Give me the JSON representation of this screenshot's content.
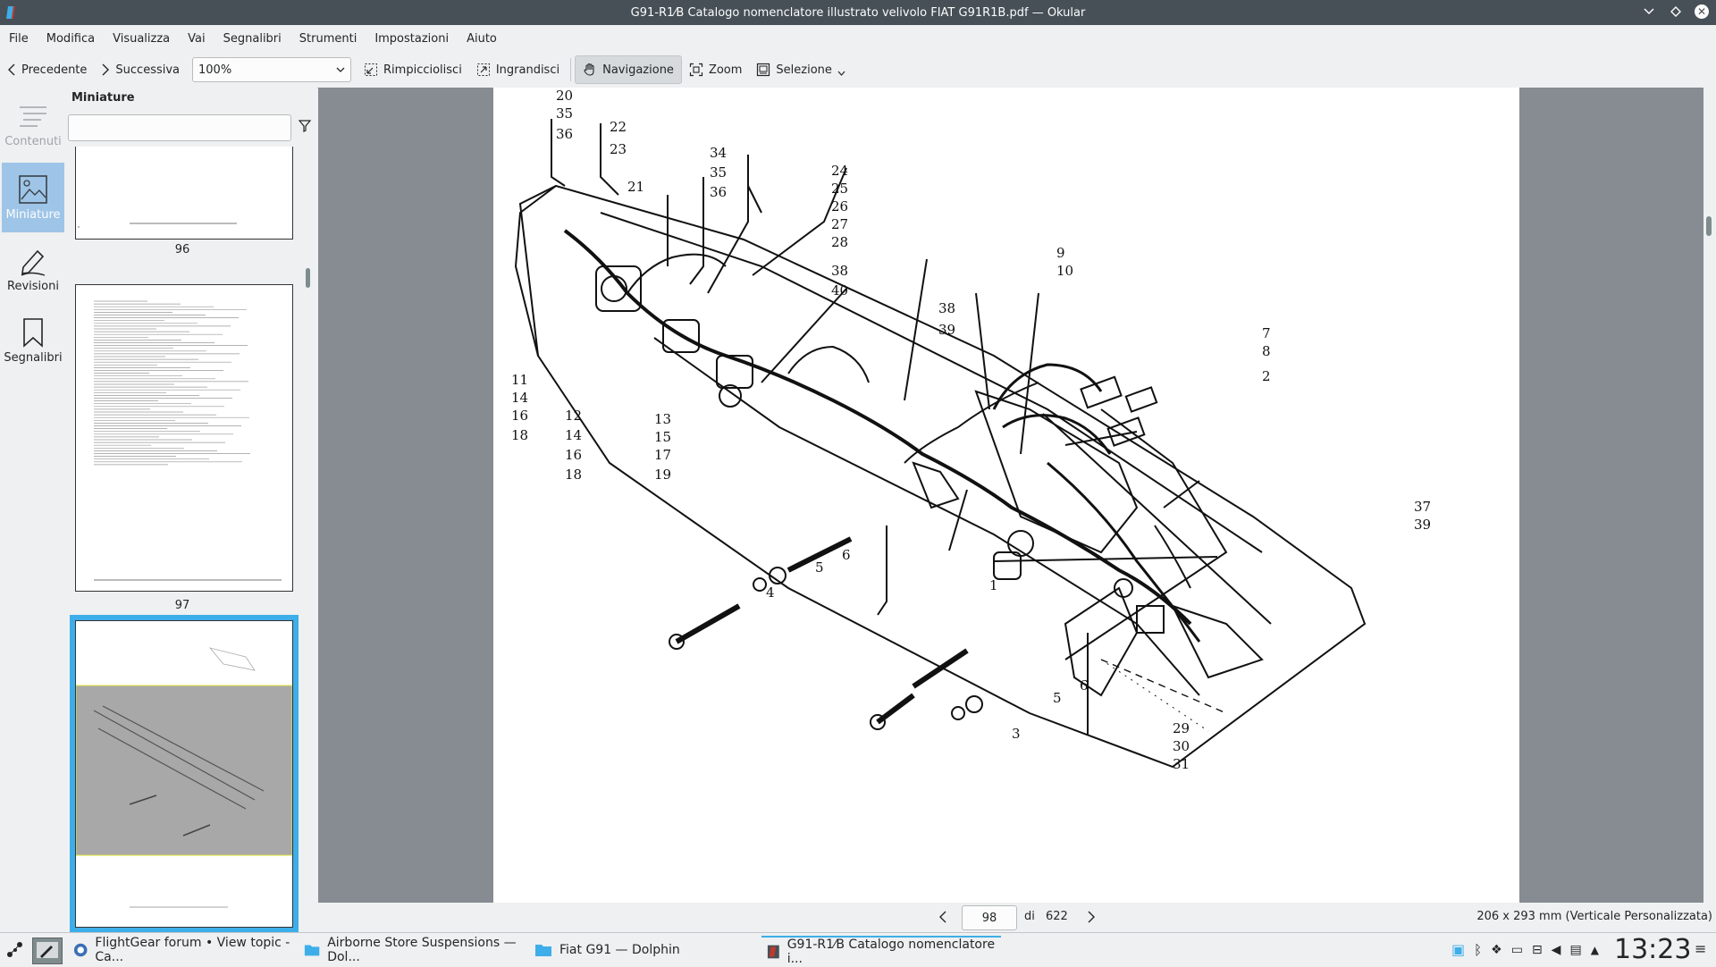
{
  "window": {
    "title": "G91-R1⁄B Catalogo nomenclatore illustrato velivolo FIAT G91R1B.pdf — Okular"
  },
  "menu": [
    "File",
    "Modifica",
    "Visualizza",
    "Vai",
    "Segnalibri",
    "Strumenti",
    "Impostazioni",
    "Aiuto"
  ],
  "toolbar": {
    "prev": "Precedente",
    "next": "Successiva",
    "zoom_value": "100%",
    "zoom_out": "Rimpicciolisci",
    "zoom_in": "Ingrandisci",
    "browse": "Navigazione",
    "zoom_tool": "Zoom",
    "selection": "Selezione"
  },
  "sidebar": {
    "items": [
      {
        "label": "Contenuti",
        "icon": "table-of-contents-icon"
      },
      {
        "label": "Miniature",
        "icon": "thumbnails-icon"
      },
      {
        "label": "Revisioni",
        "icon": "pen-icon"
      },
      {
        "label": "Segnalibri",
        "icon": "bookmark-icon"
      }
    ]
  },
  "thumbnails": {
    "title": "Miniature",
    "pages": [
      "96",
      "97",
      "98"
    ]
  },
  "drawing": {
    "callouts": [
      "20",
      "35",
      "36",
      "22",
      "23",
      "34",
      "35",
      "36",
      "21",
      "24",
      "25",
      "26",
      "27",
      "28",
      "38",
      "40",
      "9",
      "10",
      "38",
      "39",
      "7",
      "8",
      "2",
      "11",
      "14",
      "16",
      "18",
      "12",
      "14",
      "16",
      "18",
      "13",
      "15",
      "17",
      "19",
      "37",
      "39",
      "5",
      "6",
      "4",
      "1",
      "5",
      "6",
      "3",
      "29",
      "30",
      "31"
    ]
  },
  "status": {
    "current_page": "98",
    "of": "di",
    "total_pages": "622",
    "page_size": "206 x 293 mm (Verticale Personalizzata)"
  },
  "taskbar": {
    "tasks": [
      {
        "label": "FlightGear forum • View topic - Ca...",
        "icon": "browser-icon"
      },
      {
        "label": "Airborne Store Suspensions — Dol...",
        "icon": "folder-icon"
      },
      {
        "label": "Fiat G91 — Dolphin",
        "icon": "folder-icon"
      },
      {
        "label": "G91-R1⁄B Catalogo nomenclatore i...",
        "icon": "okular-icon"
      }
    ],
    "clock": "13:23"
  }
}
